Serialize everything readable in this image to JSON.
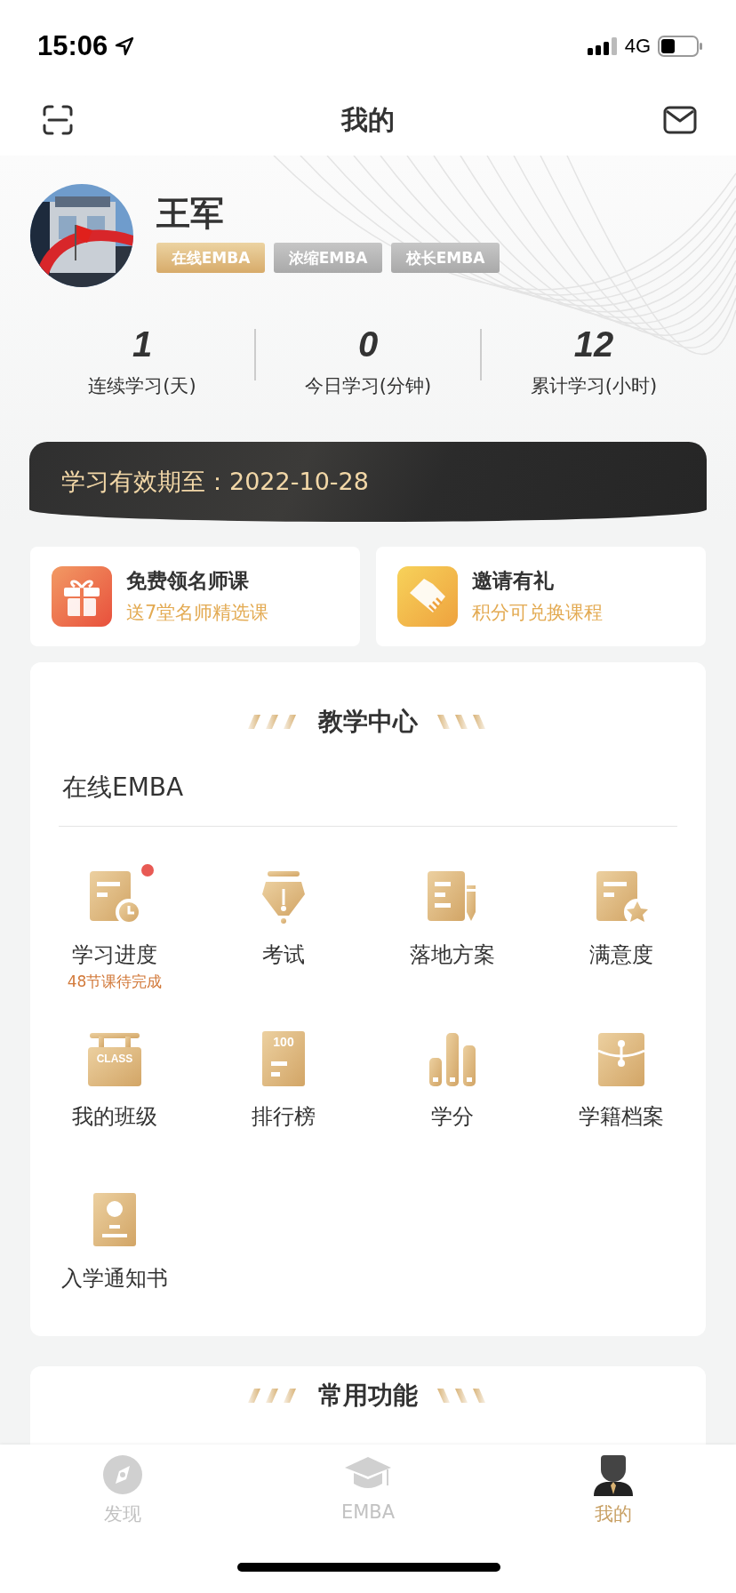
{
  "status_bar": {
    "time": "15:06",
    "network": "4G"
  },
  "nav": {
    "title": "我的"
  },
  "profile": {
    "name": "王军",
    "tags": [
      {
        "label": "在线EMBA",
        "active": true
      },
      {
        "label": "浓缩EMBA",
        "active": false
      },
      {
        "label": "校长EMBA",
        "active": false
      }
    ]
  },
  "stats": [
    {
      "value": "1",
      "label": "连续学习(天)"
    },
    {
      "value": "0",
      "label": "今日学习(分钟)"
    },
    {
      "value": "12",
      "label": "累计学习(小时)"
    }
  ],
  "validity": "学习有效期至：2022-10-28",
  "promos": [
    {
      "title": "免费领名师课",
      "subtitle": "送7堂名师精选课"
    },
    {
      "title": "邀请有礼",
      "subtitle": "积分可兑换课程"
    }
  ],
  "teaching_center": {
    "title": "教学中心",
    "program": "在线EMBA",
    "items": [
      {
        "label": "学习进度",
        "note": "48节课待完成",
        "dot": true
      },
      {
        "label": "考试",
        "dot": false
      },
      {
        "label": "落地方案",
        "dot": false
      },
      {
        "label": "满意度",
        "dot": false
      },
      {
        "label": "我的班级",
        "icon_text": "CLASS",
        "dot": false
      },
      {
        "label": "排行榜",
        "icon_text": "100",
        "dot": false
      },
      {
        "label": "学分",
        "dot": false
      },
      {
        "label": "学籍档案",
        "dot": false
      },
      {
        "label": "入学通知书",
        "dot": false
      }
    ]
  },
  "common_functions": {
    "title": "常用功能"
  },
  "tab_bar": [
    {
      "label": "发现",
      "selected": false
    },
    {
      "label": "EMBA",
      "selected": false
    },
    {
      "label": "我的",
      "selected": true
    }
  ]
}
